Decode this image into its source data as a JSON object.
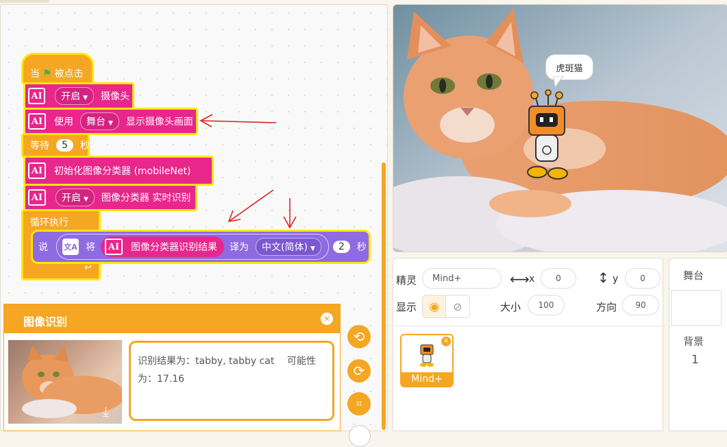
{
  "blocks": {
    "when": "当",
    "clicked": "被点击",
    "open1": "开启",
    "camera": "摄像头",
    "use": "使用",
    "stage": "舞台",
    "show_cam": "显示摄像头画面",
    "wait": "等待",
    "wait_val": "5",
    "sec": "秒",
    "init": "初始化图像分类器 (mobileNet)",
    "open2": "开启",
    "classifier_rt": "图像分类器 实时识别",
    "loop": "循环执行",
    "say": "说",
    "translate_will": "将",
    "result_label": "图像分类器识别结果",
    "translate_to": "译为",
    "lang": "中文(简体)",
    "say_secs": "2",
    "say_sec_unit": "秒"
  },
  "popup": {
    "title": "图像识别",
    "result_text": "识别结果为：tabby, tabby cat　 可能性为：17.16"
  },
  "stage": {
    "speech": "虎斑猫"
  },
  "sprite_info": {
    "sprite_label": "精灵",
    "sprite_name": "Mind+",
    "x_label": "x",
    "x": "0",
    "y_label": "y",
    "y": "0",
    "show_label": "显示",
    "size_label": "大小",
    "size": "100",
    "dir_label": "方向",
    "dir": "90",
    "thumb_label": "Mind+"
  },
  "stage_panel": {
    "title": "舞台",
    "backdrop_label": "背景",
    "backdrop_count": "1"
  },
  "colors": {
    "event": "#f5a623",
    "ai": "#e8268c",
    "looks": "#8e6be0",
    "highlight": "#ffe600",
    "arrow": "#e02020"
  }
}
